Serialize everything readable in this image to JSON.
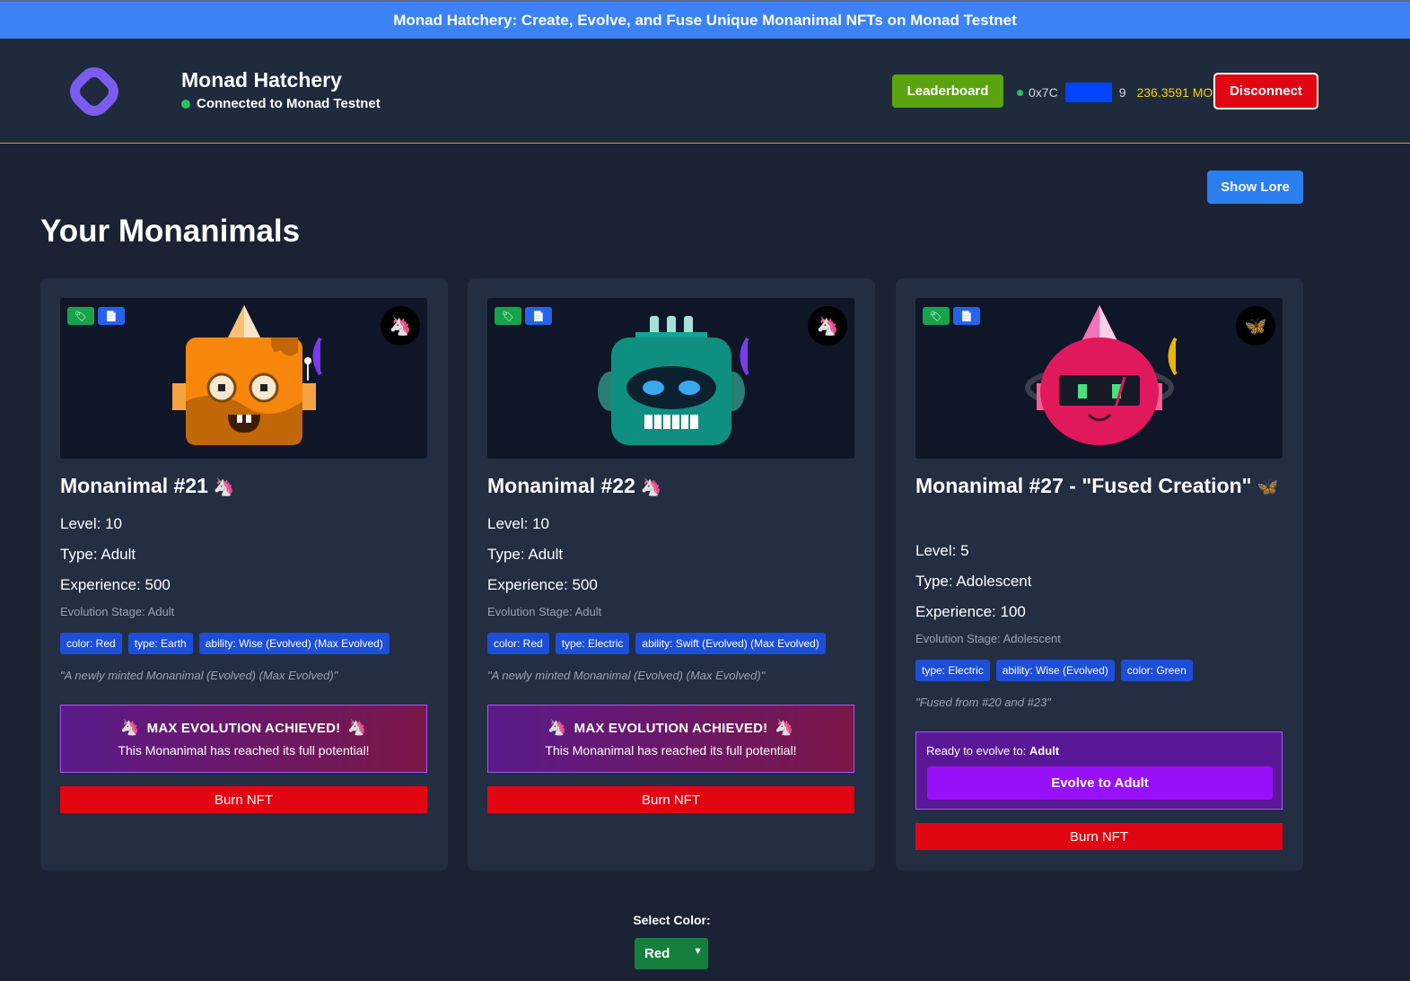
{
  "banner": {
    "text": "Monad Hatchery: Create, Evolve, and Fuse Unique Monanimal NFTs on Monad Testnet"
  },
  "header": {
    "title": "Monad Hatchery",
    "status": "Connected to Monad Testnet",
    "leaderboard_label": "Leaderboard",
    "wallet_prefix": "0x7C",
    "wallet_suffix": "9",
    "balance": "236.3591 MON",
    "disconnect_label": "Disconnect"
  },
  "lore_label": "Show Lore",
  "section_title": "Your Monanimals",
  "cards": [
    {
      "title": "Monanimal #21",
      "emoji": "🦄",
      "level": "Level: 10",
      "type": "Type: Adult",
      "experience": "Experience: 500",
      "stage": "Evolution Stage: Adult",
      "tags": [
        "color: Red",
        "type: Earth",
        "ability: Wise (Evolved) (Max Evolved)"
      ],
      "description": "\"A newly minted Monanimal (Evolved) (Max Evolved)\"",
      "max_title": "MAX EVOLUTION ACHIEVED!",
      "max_sub": "This Monanimal has reached its full potential!",
      "burn_label": "Burn NFT"
    },
    {
      "title": "Monanimal #22",
      "emoji": "🦄",
      "level": "Level: 10",
      "type": "Type: Adult",
      "experience": "Experience: 500",
      "stage": "Evolution Stage: Adult",
      "tags": [
        "color: Red",
        "type: Electric",
        "ability: Swift (Evolved) (Max Evolved)"
      ],
      "description": "\"A newly minted Monanimal (Evolved) (Max Evolved)\"",
      "max_title": "MAX EVOLUTION ACHIEVED!",
      "max_sub": "This Monanimal has reached its full potential!",
      "burn_label": "Burn NFT"
    },
    {
      "title": "Monanimal #27 - \"Fused Creation\"",
      "emoji": "🦋",
      "level": "Level: 5",
      "type": "Type: Adolescent",
      "experience": "Experience: 100",
      "stage": "Evolution Stage: Adolescent",
      "tags": [
        "type: Electric",
        "ability: Wise (Evolved)",
        "color: Green"
      ],
      "description": "\"Fused from #20 and #23\"",
      "ready_prefix": "Ready to evolve to:",
      "ready_target": "Adult",
      "evolve_label": "Evolve to Adult",
      "burn_label": "Burn NFT"
    }
  ],
  "color_picker": {
    "label": "Select Color:",
    "selected": "Red"
  },
  "colors": {
    "banner": "#3b82f6",
    "leaderboard": "#5aa50f",
    "disconnect": "#e10612",
    "burn": "#e10612",
    "evolve": "#9810fa",
    "tag": "#1d4ed8",
    "select": "#15803d"
  }
}
